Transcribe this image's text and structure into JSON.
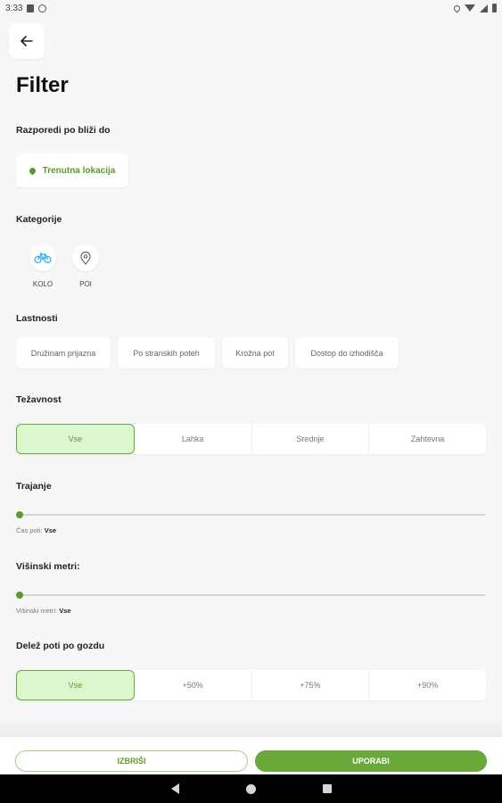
{
  "status_bar": {
    "time": "3:33"
  },
  "header": {
    "title": "Filter"
  },
  "sort": {
    "title": "Razporedi po bliži do",
    "location_label": "Trenutna lokacija"
  },
  "categories": {
    "title": "Kategorije",
    "items": [
      {
        "label": "KOLO",
        "icon": "bicycle-icon"
      },
      {
        "label": "POI",
        "icon": "map-pin-icon"
      }
    ]
  },
  "properties": {
    "title": "Lastnosti",
    "chips": [
      "Družinam prijazna",
      "Po stranskih poteh",
      "Krožna pot",
      "Dostop do izhodišča"
    ]
  },
  "difficulty": {
    "title": "Težavnost",
    "options": [
      "Vse",
      "Lahka",
      "Srednje",
      "Zahtevna"
    ],
    "selected": "Vse"
  },
  "duration": {
    "title": "Trajanje",
    "caption_label": "Čas poti:",
    "caption_value": "Vse",
    "value_fraction": 0
  },
  "elevation": {
    "title": "Višinski metri:",
    "caption_label": "Višinski metri:",
    "caption_value": "Vse",
    "value_fraction": 0
  },
  "forest": {
    "title": "Delež poti po gozdu",
    "options": [
      "Vse",
      "+50%",
      "+75%",
      "+90%"
    ],
    "selected": "Vse"
  },
  "actions": {
    "clear_label": "IZBRIŠI",
    "apply_label": "UPORABI"
  },
  "colors": {
    "accent": "#6aa83a",
    "accent_light": "#dcf6cd",
    "background": "#f7f7f7"
  }
}
